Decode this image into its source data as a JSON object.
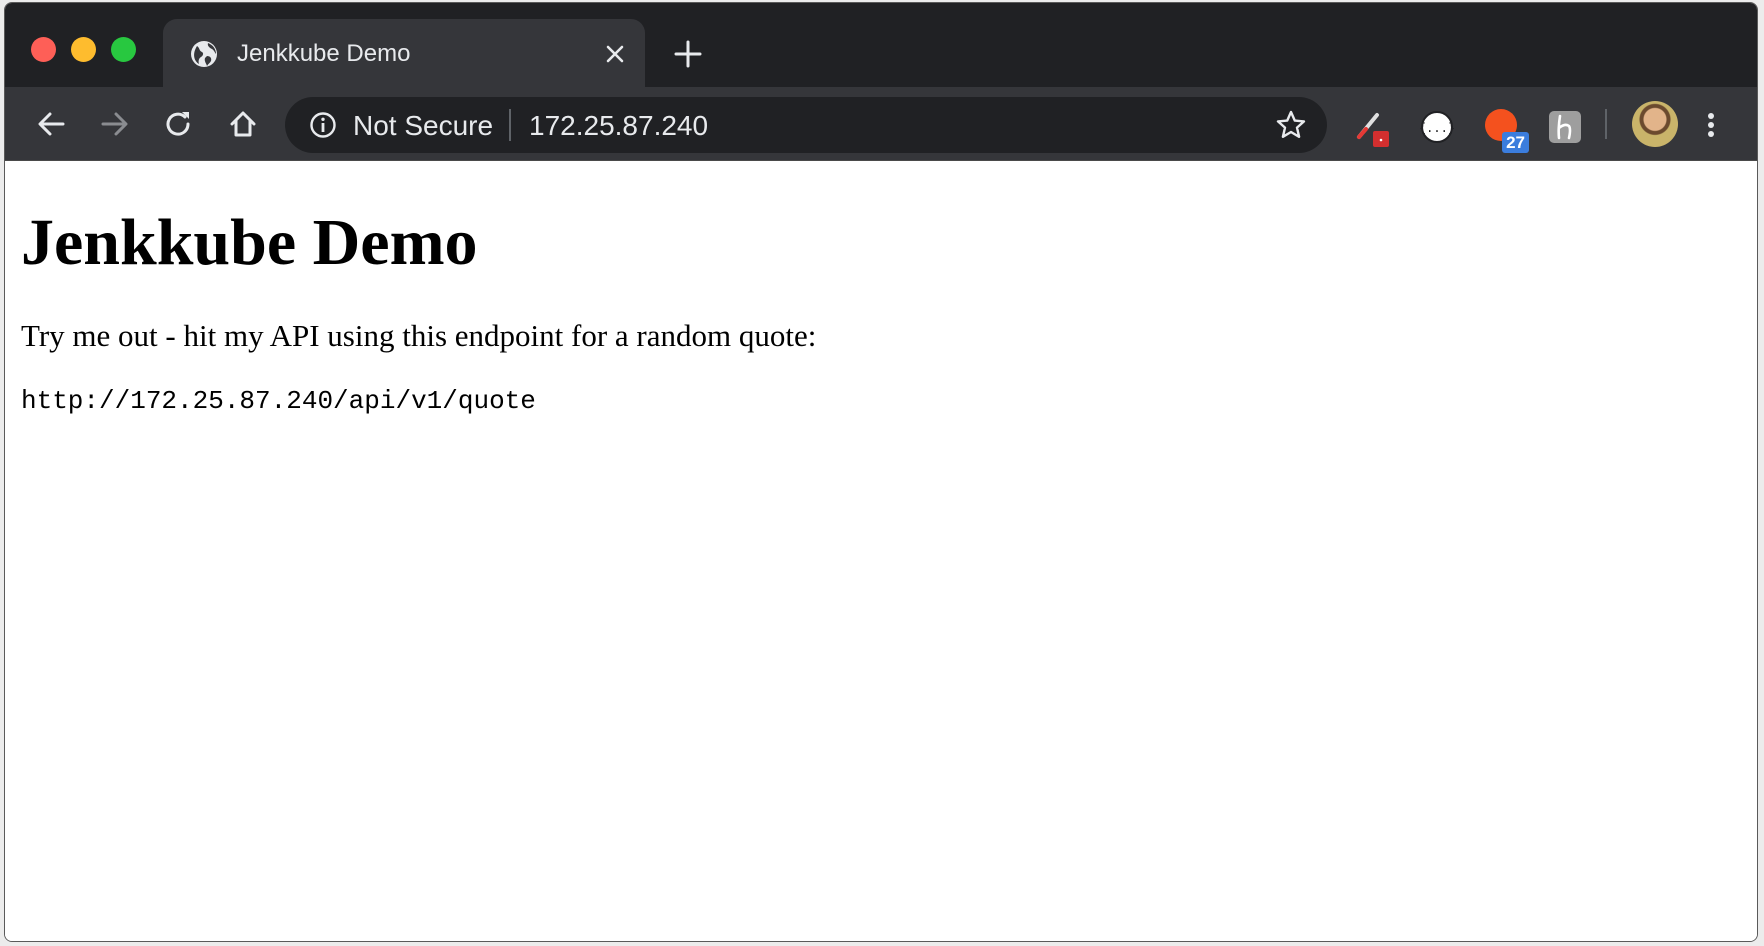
{
  "tab": {
    "title": "Jenkkube Demo",
    "favicon_icon": "globe-icon",
    "close_icon": "close-icon"
  },
  "toolbar": {
    "new_tab_icon": "plus-icon",
    "back_icon": "arrow-left-icon",
    "forward_icon": "arrow-right-icon",
    "reload_icon": "reload-icon",
    "home_icon": "home-icon"
  },
  "omnibox": {
    "security_label": "Not Secure",
    "url": "172.25.87.240",
    "info_icon": "info-icon",
    "bookmark_icon": "star-icon"
  },
  "extensions": [
    {
      "name": "eyedropper-extension-icon"
    },
    {
      "name": "json-viewer-extension-icon"
    },
    {
      "name": "orange-extension-icon",
      "badge": "27"
    },
    {
      "name": "h-extension-icon"
    }
  ],
  "page": {
    "heading": "Jenkkube Demo",
    "intro": "Try me out - hit my API using this endpoint for a random quote:",
    "endpoint": "http://172.25.87.240/api/v1/quote"
  },
  "colors": {
    "titlebar": "#202124",
    "toolbar": "#35363a",
    "omnibox": "#202124",
    "badge": "#3b7ddd",
    "extension_orange": "#f4511e"
  }
}
